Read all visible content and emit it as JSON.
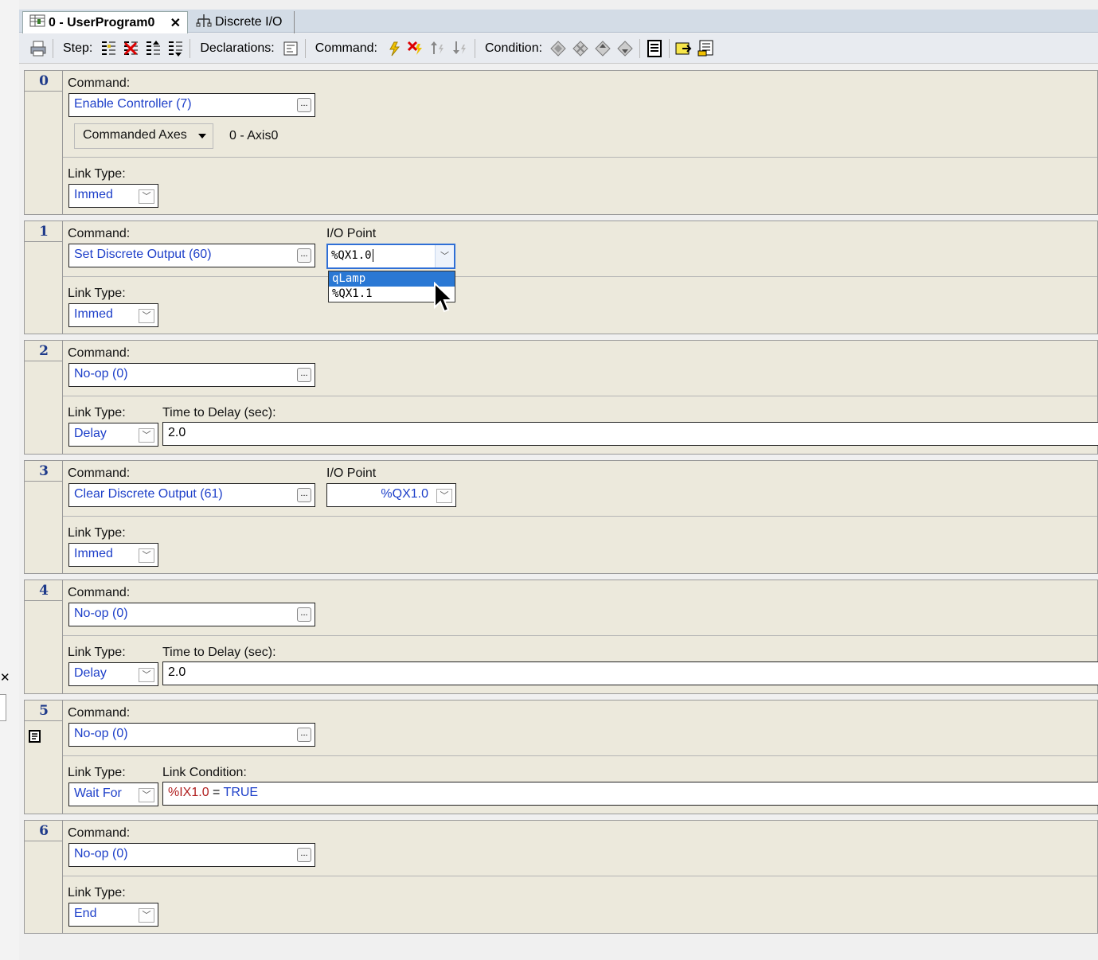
{
  "tabs": [
    {
      "label": "0 - UserProgram0",
      "icon": "program-grid-icon",
      "active": true,
      "close": "✕"
    },
    {
      "label": "Discrete I/O",
      "icon": "io-network-icon",
      "active": false
    }
  ],
  "toolbar": {
    "step_label": "Step:",
    "declarations_label": "Declarations:",
    "command_label": "Command:",
    "condition_label": "Condition:"
  },
  "labels": {
    "command": "Command:",
    "link_type": "Link Type:",
    "io_point": "I/O Point",
    "time_to_delay": "Time to Delay (sec):",
    "link_condition": "Link Condition:",
    "ellipsis": "..."
  },
  "steps": [
    {
      "num": "0",
      "command": "Enable Controller (7)",
      "axes_button": "Commanded Axes",
      "axes_value": "0 - Axis0",
      "link_type": "Immed"
    },
    {
      "num": "1",
      "command": "Set Discrete Output (60)",
      "io_value": "%QX1.0",
      "link_type": "Immed",
      "dropdown": [
        "qLamp",
        "%QX1.1"
      ]
    },
    {
      "num": "2",
      "command": "No-op (0)",
      "link_type": "Delay",
      "delay": "2.0"
    },
    {
      "num": "3",
      "command": "Clear Discrete Output (61)",
      "io_value": "%QX1.0",
      "link_type": "Immed"
    },
    {
      "num": "4",
      "command": "No-op (0)",
      "link_type": "Delay",
      "delay": "2.0"
    },
    {
      "num": "5",
      "command": "No-op (0)",
      "link_type": "Wait For",
      "condition_var": "%IX1.0",
      "condition_op": "=",
      "condition_val": "TRUE"
    },
    {
      "num": "6",
      "command": "No-op (0)",
      "link_type": "End"
    }
  ],
  "edge": {
    "close": "✕"
  }
}
